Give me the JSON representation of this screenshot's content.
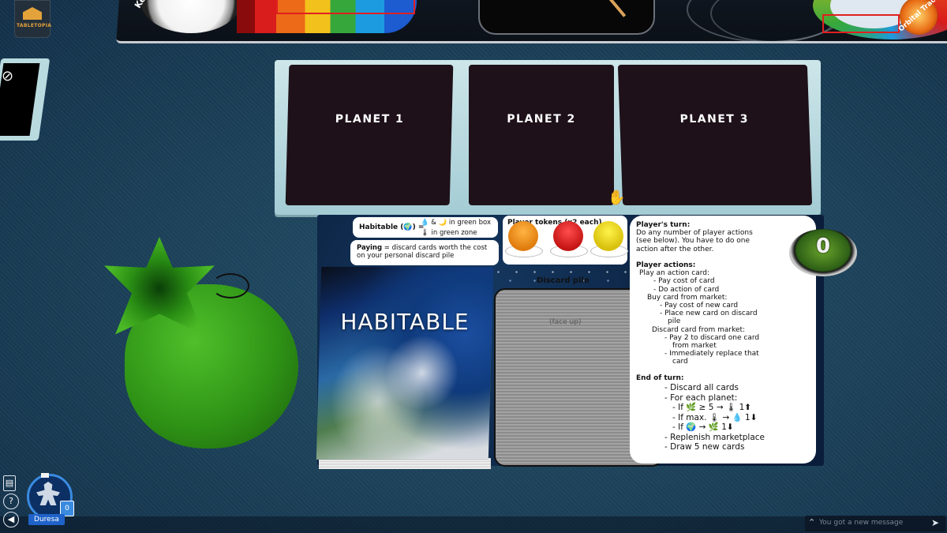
{
  "app": {
    "logo_text": "TABLETOPIA"
  },
  "top_board": {
    "kepler_label": "Kepler",
    "track_label": "Orbital Track"
  },
  "planets": [
    {
      "label": "PLANET 1"
    },
    {
      "label": "PLANET 2"
    },
    {
      "label": "PLANET 3"
    }
  ],
  "player_board": {
    "habitable_rule": {
      "label": "Habitable (🌍) =",
      "line1": "💧 & 🌙 in green box",
      "line2": "🌡 in green zone"
    },
    "paying_rule": {
      "bold": "Paying",
      "text": " = discard cards worth the cost on your personal discard pile"
    },
    "tokens_label": "Player tokens (x2 each)",
    "token_colors": [
      "#f28c1a",
      "#e52323",
      "#f5dd1a"
    ],
    "discard_label": "Discard pile",
    "discard_sub": "(face up)",
    "deck_title": "HABITABLE"
  },
  "turn_card": {
    "lines": [
      {
        "text": "Player's turn:",
        "bold": true
      },
      {
        "text": "Do any number of player actions"
      },
      {
        "text": "(see below). You have to do one"
      },
      {
        "text": "action after the other."
      },
      {
        "text": ""
      },
      {
        "text": "Player actions:",
        "bold": true
      },
      {
        "text": "Play an action card:"
      },
      {
        "text": "- Pay cost of card"
      },
      {
        "text": "- Do action of card"
      },
      {
        "text": "Buy card from market:"
      },
      {
        "text": "- Pay cost of new card"
      },
      {
        "text": "- Place new card on discard"
      },
      {
        "text": "pile"
      },
      {
        "text": "Discard card from market:"
      },
      {
        "text": "- Pay 2 to discard one card"
      },
      {
        "text": "from market"
      },
      {
        "text": "- Immediately replace that"
      },
      {
        "text": "card"
      },
      {
        "text": ""
      },
      {
        "text": "End of turn:",
        "bold": true
      },
      {
        "text": "- Discard all cards"
      },
      {
        "text": "- For each planet:"
      },
      {
        "text": "- If 🌿 ≥ 5 → 🌡 1⬆"
      },
      {
        "text": "- If max. 🌡 → 💧 1⬇"
      },
      {
        "text": "- If 🌍 → 🌿 1⬇"
      },
      {
        "text": "- Replenish marketplace"
      },
      {
        "text": "- Draw 5 new cards"
      }
    ]
  },
  "score": {
    "value": "0"
  },
  "player": {
    "name": "Duresa",
    "card_count": "0"
  },
  "side_buttons": [
    {
      "name": "notes-icon",
      "glyph": "▤"
    },
    {
      "name": "help-icon",
      "glyph": "?"
    },
    {
      "name": "sound-icon",
      "glyph": "◀"
    }
  ],
  "chat": {
    "placeholder": "You got a new message",
    "up_glyph": "⌃",
    "send_glyph": "➤"
  },
  "colors": {
    "table": "#1b4058",
    "planet_card": "#1e1119",
    "player_badge": "#1f63c9"
  }
}
